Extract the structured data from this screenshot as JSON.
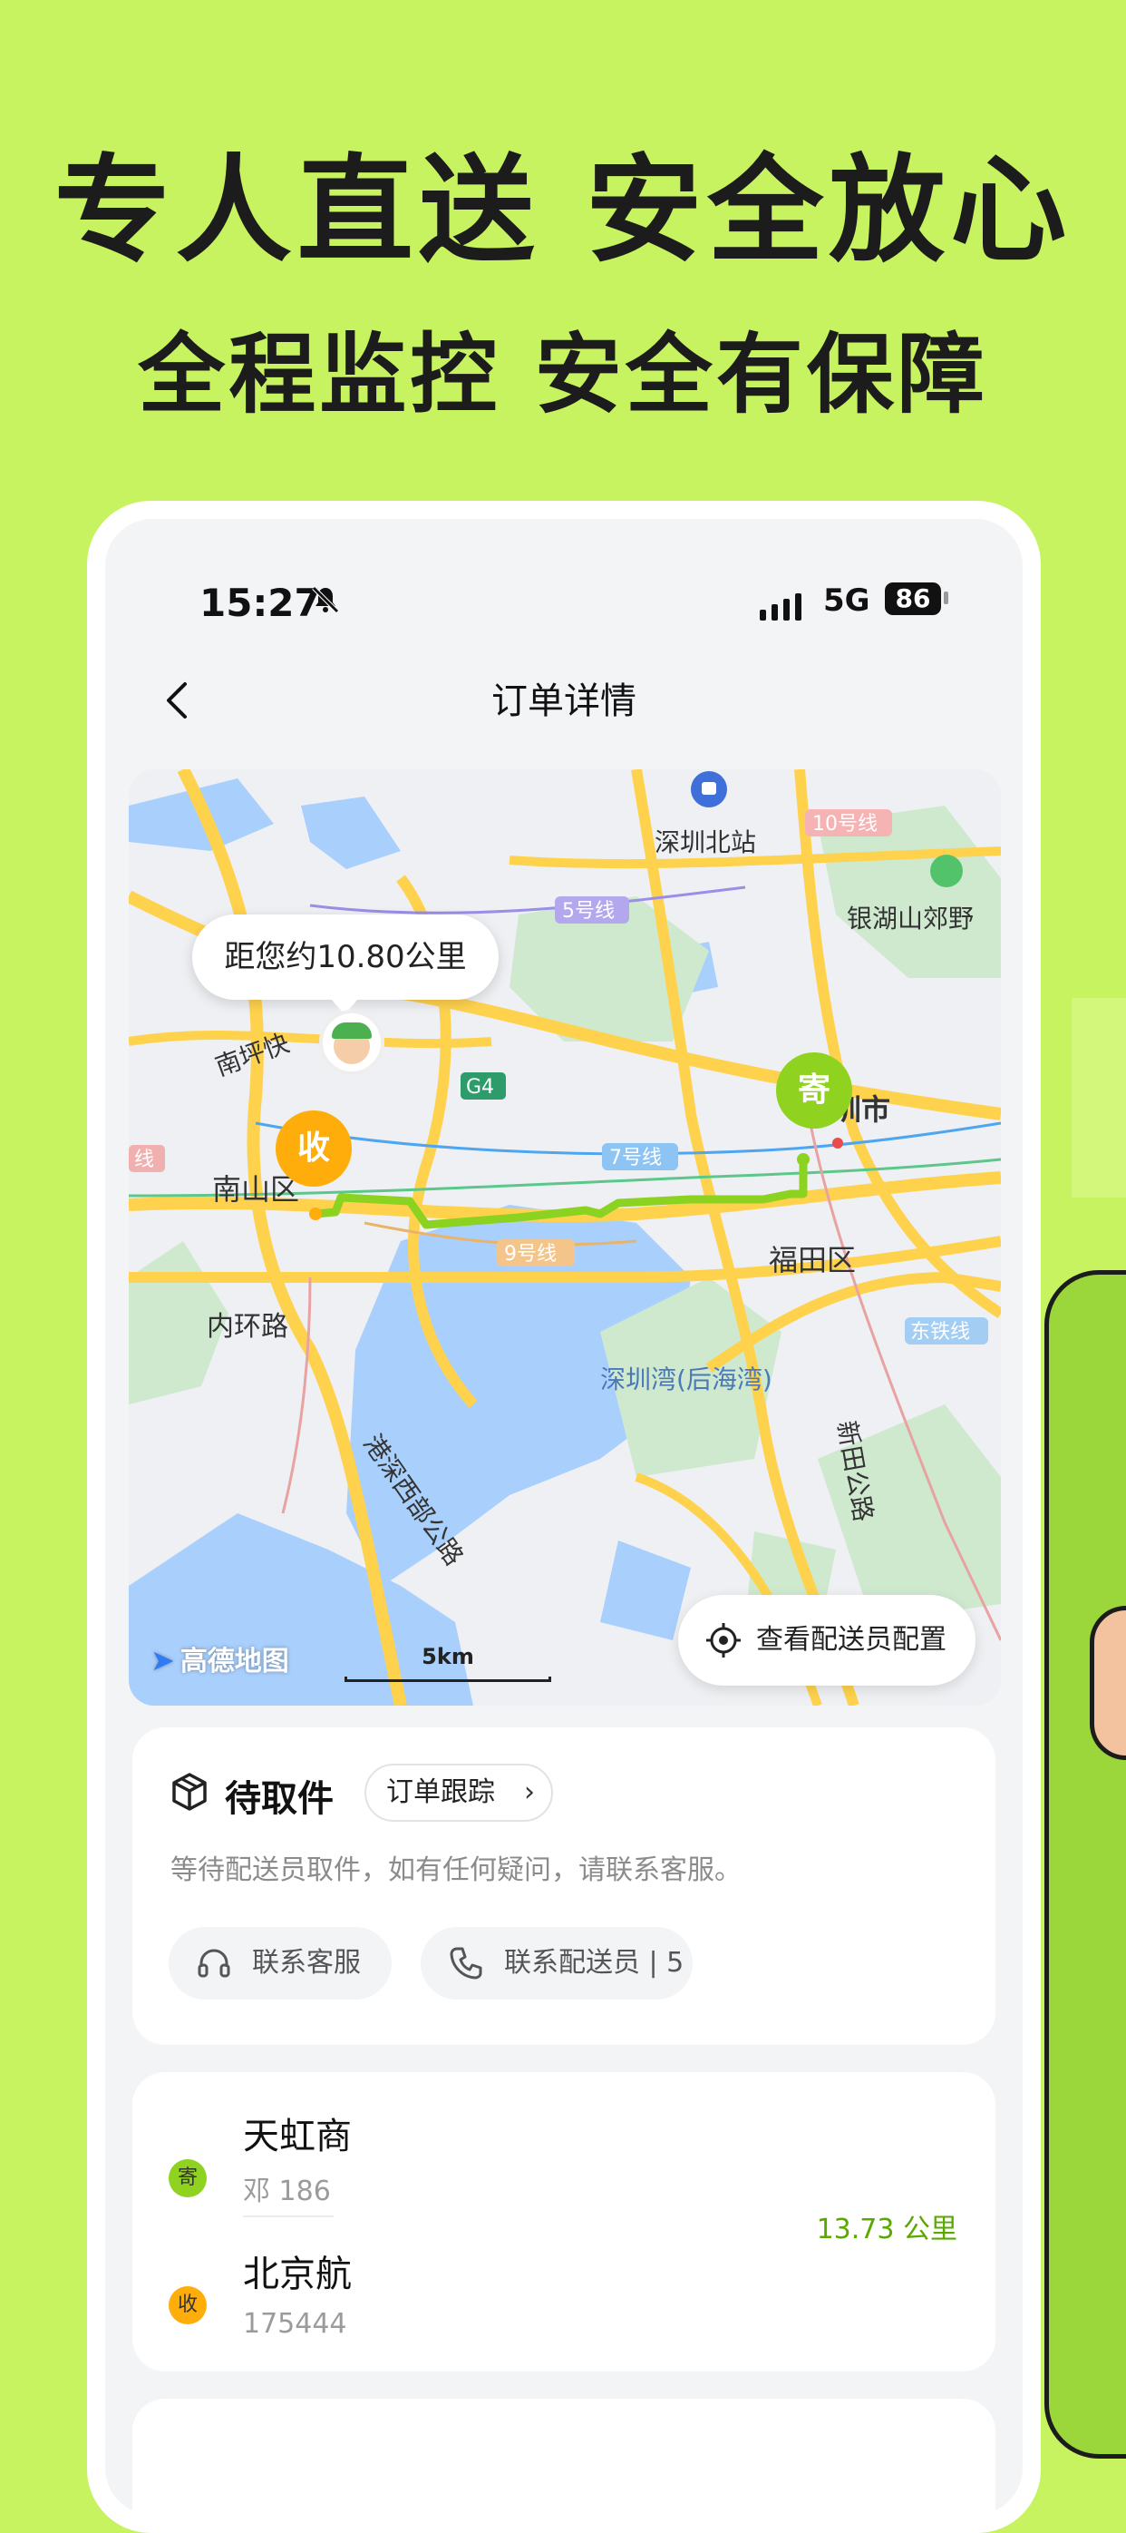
{
  "promo": {
    "headline": "专人直送 安全放心",
    "subline": "全程监控 安全有保障"
  },
  "status_bar": {
    "time": "15:27",
    "network": "5G",
    "battery": "86"
  },
  "nav": {
    "title": "订单详情"
  },
  "map": {
    "distance_bubble": "距您约10.80公里",
    "pin_receive": "收",
    "pin_send": "寄",
    "locate_button": "查看配送员配置",
    "logo": "高德地图",
    "scale": "5km",
    "labels": {
      "shenzhen_north": "深圳北站",
      "line10": "10号线",
      "line5": "5号线",
      "yinhu": "银湖山郊野",
      "nanping": "南坪快",
      "g4": "G4",
      "city": "圳市",
      "nanshan": "南山区",
      "line7": "7号线",
      "line9": "9号线",
      "futian": "福田区",
      "neihuan": "内环路",
      "dongtie": "东铁线",
      "bay": "深圳湾(后海湾)",
      "xintian": "新田公路",
      "gangshen": "港深西部公路",
      "line_edge": "线"
    }
  },
  "status_card": {
    "title": "待取件",
    "track_button": "订单跟踪",
    "description": "等待配送员取件，如有任何疑问，请联系客服。",
    "service_button": "联系客服",
    "rider_button": "联系配送员 | 5"
  },
  "address_card": {
    "send_badge": "寄",
    "send_name": "天虹商",
    "send_contact": "邓 186",
    "receive_badge": "收",
    "receive_name": "北京航",
    "receive_contact": "175444",
    "distance": "13.73 公里"
  },
  "colors": {
    "background": "#c6f35f",
    "send_green": "#8fd21f",
    "receive_orange": "#ffad0a",
    "distance_green": "#5aa800"
  }
}
